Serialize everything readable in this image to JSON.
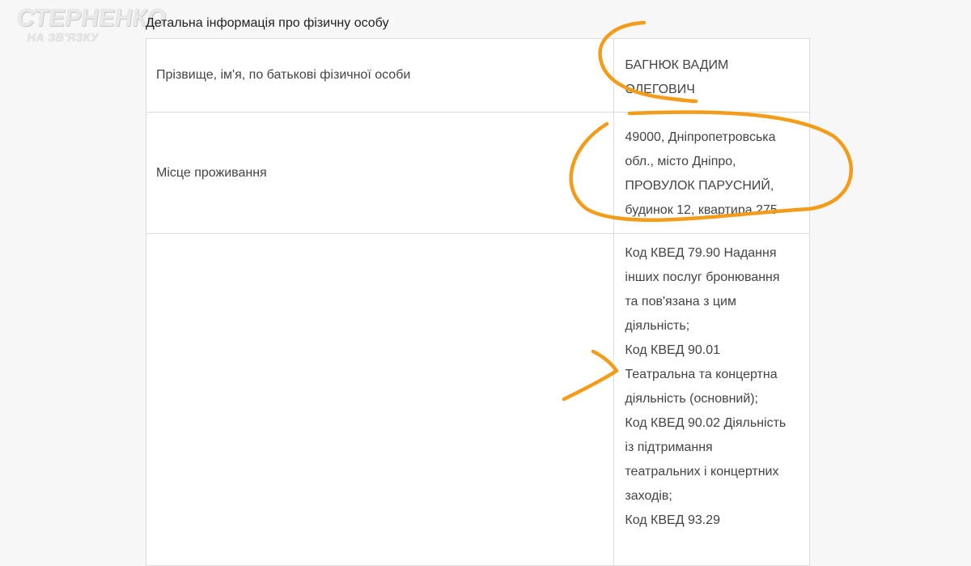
{
  "logo": {
    "top": "СТЕРНЕНКО",
    "bottom": "НА ЗВ'ЯЗКУ"
  },
  "section_title": "Детальна інформація про фізичну особу",
  "rows": [
    {
      "label": "Прізвище, ім'я, по батькові фізичної особи",
      "value_lines": [
        "БАГНЮК ВАДИМ",
        "ОЛЕГОВИЧ"
      ]
    },
    {
      "label": "Місце проживання",
      "value_lines": [
        "49000, Дніпропетровська",
        "обл., місто Дніпро,",
        "ПРОВУЛОК ПАРУСНИЙ,",
        "будинок 12, квартира 275"
      ]
    },
    {
      "label": "",
      "value_lines": [
        "Код КВЕД 79.90 Надання",
        "інших послуг бронювання",
        "та пов'язана з цим",
        "діяльність;",
        "Код КВЕД 90.01",
        "Театральна та концертна",
        "діяльність (основний);",
        "Код КВЕД 90.02 Діяльність",
        "із підтримання",
        "театральних і концертних",
        "заходів;",
        "Код КВЕД 93.29"
      ]
    }
  ],
  "annotation_color": "#f39c1a"
}
